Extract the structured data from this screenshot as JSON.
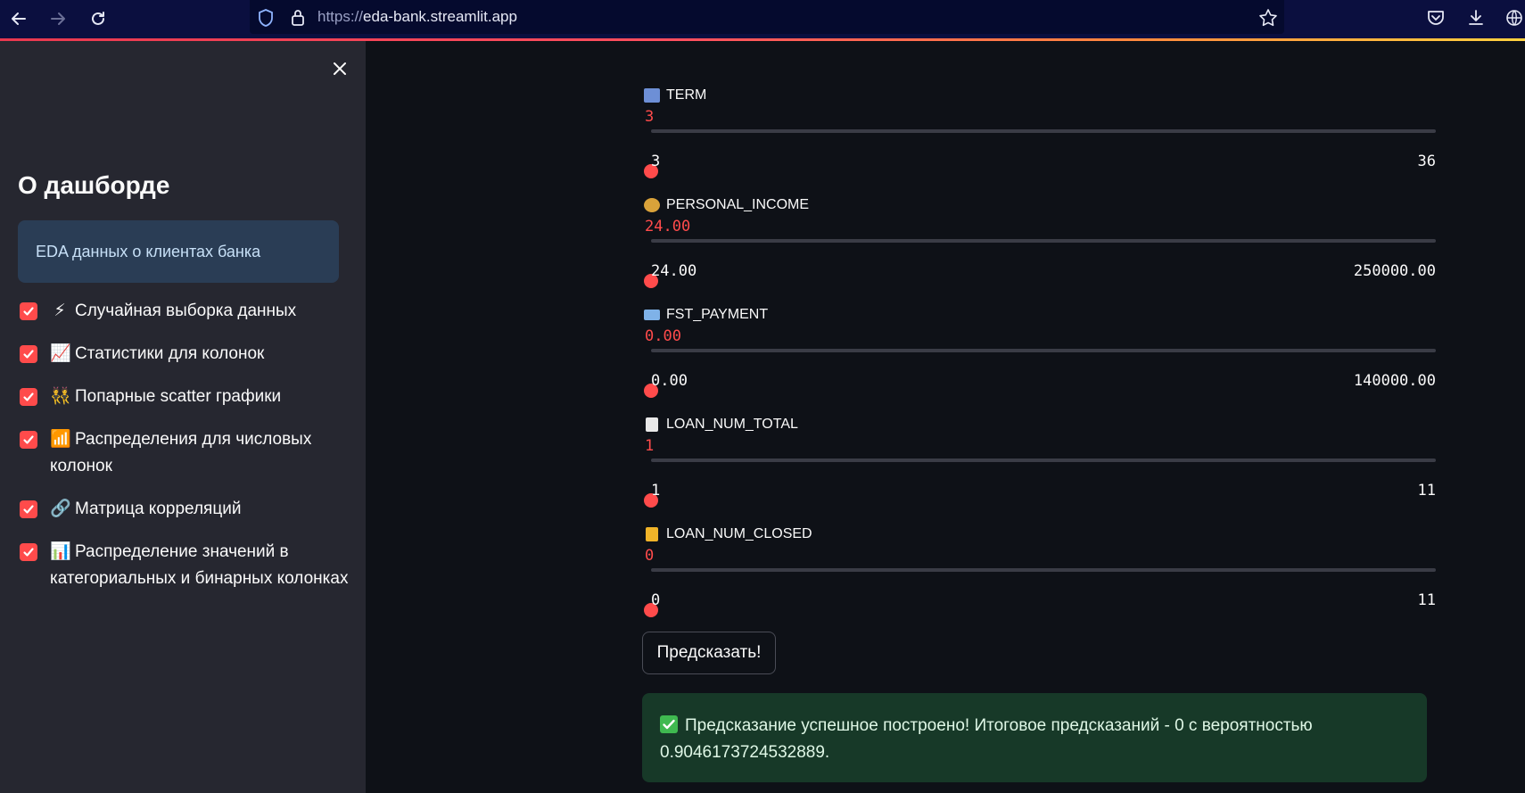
{
  "browser": {
    "url_scheme": "https://",
    "url_host": "eda-bank.streamlit.app"
  },
  "sidebar": {
    "title": "О дашборде",
    "info": "EDA данных о клиентах банка",
    "checkboxes": [
      {
        "emoji": "⚡",
        "label": "Случайная выборка данных",
        "checked": true
      },
      {
        "emoji": "📈",
        "label": "Статистики для колонок",
        "checked": true
      },
      {
        "emoji": "👯",
        "label": "Попарные scatter графики",
        "checked": true
      },
      {
        "emoji": "📶",
        "label": "Распределения для числовых колонок",
        "checked": true
      },
      {
        "emoji": "🔗",
        "label": "Матрица корреляций",
        "checked": true
      },
      {
        "emoji": "📊",
        "label": "Распределение значений в категориальных и бинарных колонках",
        "checked": true
      }
    ]
  },
  "sliders": [
    {
      "icon": "calendar-icon",
      "label": "TERM",
      "value": "3",
      "min": "3",
      "max": "36",
      "position": 0
    },
    {
      "icon": "money-bag-icon",
      "label": "PERSONAL_INCOME",
      "value": "24.00",
      "min": "24.00",
      "max": "250000.00",
      "position": 0
    },
    {
      "icon": "credit-card-icon",
      "label": "FST_PAYMENT",
      "value": "0.00",
      "min": "0.00",
      "max": "140000.00",
      "position": 0
    },
    {
      "icon": "memo-icon",
      "label": "LOAN_NUM_TOTAL",
      "value": "1",
      "min": "1",
      "max": "11",
      "position": 0
    },
    {
      "icon": "lock-icon",
      "label": "LOAN_NUM_CLOSED",
      "value": "0",
      "min": "0",
      "max": "11",
      "position": 0
    }
  ],
  "predict_button": "Предсказать!",
  "result": {
    "text": "Предсказание успешное построено! Итоговое предсказаний - 0 с вероятностью 0.9046173724532889."
  },
  "colors": {
    "accent": "#ff4b4b",
    "background": "#0e1117",
    "sidebar": "#262730",
    "info_bg": "#2a3d55",
    "success_bg": "#173928"
  }
}
